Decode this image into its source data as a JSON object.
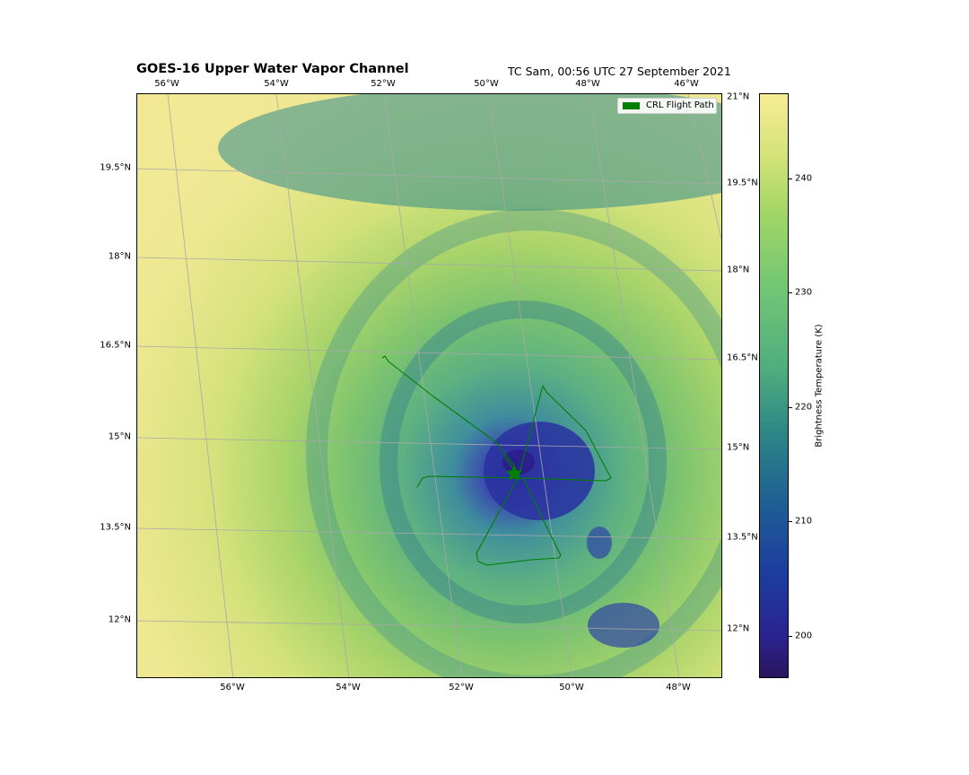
{
  "header": {
    "title": "GOES-16 Upper Water Vapor Channel",
    "subtitle": "TC Sam, 00:56 UTC 27 September 2021"
  },
  "map": {
    "ticks_top": [
      "56°W",
      "54°W",
      "52°W",
      "50°W",
      "48°W",
      "46°W"
    ],
    "ticks_bottom": [
      "56°W",
      "54°W",
      "52°W",
      "50°W",
      "48°W"
    ],
    "ticks_left": [
      "19.5°N",
      "18°N",
      "16.5°N",
      "15°N",
      "13.5°N",
      "12°N"
    ],
    "ticks_right": [
      "21°N",
      "19.5°N",
      "18°N",
      "16.5°N",
      "15°N",
      "13.5°N",
      "12°N"
    ],
    "gridline_color": "#a8a8a8"
  },
  "legend": {
    "label": "CRL Flight Path",
    "color": "#007f00",
    "location": "upper right"
  },
  "flight": {
    "marker": "star-icon",
    "color": "#007f00"
  },
  "colorbar": {
    "label": "Brightness Temperature (K)",
    "ticks": [
      "240",
      "230",
      "220",
      "210",
      "200"
    ],
    "range": [
      196,
      248
    ],
    "colormap": [
      "#f8ec97",
      "#a4d766",
      "#4fae7e",
      "#1f5f94",
      "#2b2390",
      "#2a155d"
    ]
  }
}
